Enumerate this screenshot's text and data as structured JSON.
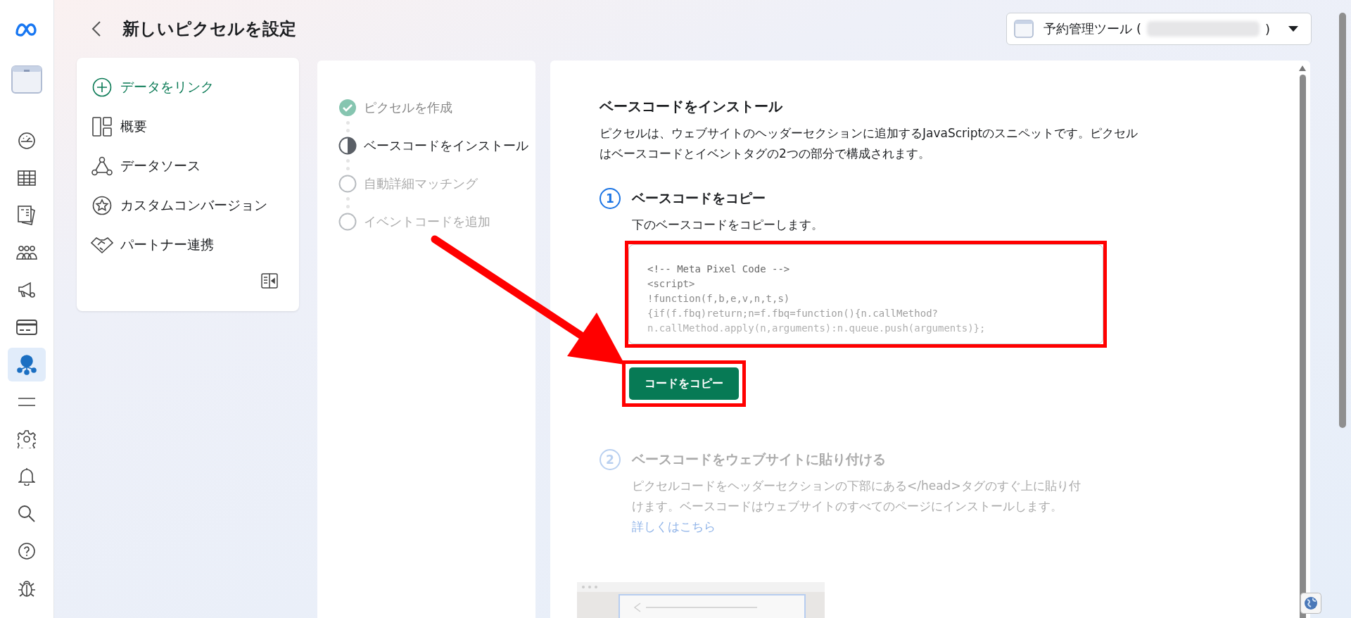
{
  "rail": [
    {
      "kind": "logo",
      "selected": false
    },
    {
      "kind": "business",
      "selected": false
    },
    {
      "kind": "gauge",
      "selected": false
    },
    {
      "kind": "table",
      "selected": false
    },
    {
      "kind": "pages",
      "selected": false
    },
    {
      "kind": "people",
      "selected": false
    },
    {
      "kind": "megaphone",
      "selected": false
    },
    {
      "kind": "card",
      "selected": false
    },
    {
      "kind": "pixel",
      "selected": true
    },
    {
      "kind": "menu",
      "selected": false
    },
    {
      "kind": "gear",
      "selected": false
    },
    {
      "kind": "bell",
      "selected": false
    },
    {
      "kind": "search",
      "selected": false
    },
    {
      "kind": "help",
      "selected": false
    },
    {
      "kind": "bug",
      "selected": false
    }
  ],
  "header": {
    "title": "新しいピクセルを設定",
    "account": {
      "name": "予約管理ツール (",
      "suffix": ")"
    }
  },
  "nav": {
    "items": [
      {
        "kind": "action",
        "label": "データをリンク"
      },
      {
        "kind": "overview",
        "label": "概要"
      },
      {
        "kind": "sources",
        "label": "データソース"
      },
      {
        "kind": "conversion",
        "label": "カスタムコンバージョン"
      },
      {
        "kind": "partner",
        "label": "パートナー連携"
      }
    ]
  },
  "steps": [
    {
      "label": "ピクセルを作成",
      "completed": true,
      "current": false
    },
    {
      "label": "ベースコードをインストール",
      "completed": false,
      "current": true
    },
    {
      "label": "自動詳細マッチング",
      "completed": false,
      "current": false
    },
    {
      "label": "イベントコードを追加",
      "completed": false,
      "current": false
    }
  ],
  "content": {
    "heading": "ベースコードをインストール",
    "intro": "ピクセルは、ウェブサイトのヘッダーセクションに追加するJavaScriptのスニペットです。ピクセルはベースコードとイベントタグの2つの部分で構成されます。",
    "install_steps": [
      {
        "number": "1",
        "title": "ベースコードをコピー",
        "active": true,
        "text": "下のベースコードをコピーします。",
        "code": [
          "<!-- Meta Pixel Code -->",
          "<script>",
          "!function(f,b,e,v,n,t,s)",
          "{if(f.fbq)return;n=f.fbq=function(){n.callMethod?",
          "n.callMethod.apply(n,arguments):n.queue.push(arguments)};"
        ],
        "button": "コードをコピー"
      },
      {
        "number": "2",
        "title": "ベースコードをウェブサイトに貼り付ける",
        "active": false,
        "text": "ピクセルコードをヘッダーセクションの下部にある</head>タグのすぐ上に貼り付けます。ベースコードはウェブサイトのすべてのページにインストールします。",
        "link": "詳しくはこちら"
      }
    ]
  }
}
